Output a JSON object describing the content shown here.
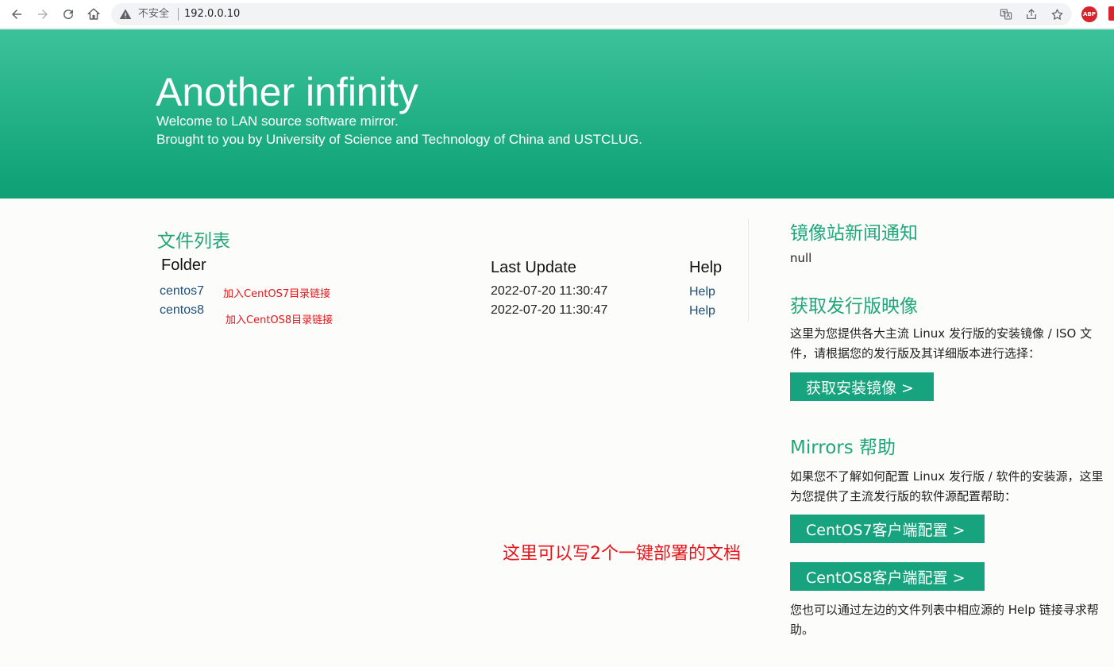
{
  "browser": {
    "security_label": "不安全",
    "url": "192.0.0.10",
    "abp_label": "ABP"
  },
  "header": {
    "title": "Another infinity",
    "line1": "Welcome to LAN source software mirror.",
    "line2": "Brought to you by University of Science and Technology of China and USTCLUG."
  },
  "files": {
    "title": "文件列表",
    "columns": {
      "folder": "Folder",
      "last_update": "Last Update",
      "help": "Help"
    },
    "rows": [
      {
        "folder": "centos7",
        "note": "加入CentOS7目录链接",
        "last_update": "2022-07-20 11:30:47",
        "help": "Help"
      },
      {
        "folder": "centos8",
        "note": "加入CentOS8目录链接",
        "last_update": "2022-07-20 11:30:47",
        "help": "Help"
      }
    ]
  },
  "annotation": "这里可以写2个一键部署的文档",
  "news": {
    "title": "镜像站新闻通知",
    "content": "null"
  },
  "distro": {
    "title": "获取发行版映像",
    "description": "这里为您提供各大主流 Linux 发行版的安装镜像 / ISO 文件，请根据您的发行版及其详细版本进行选择：",
    "button": "获取安装镜像 >"
  },
  "mirrors_help": {
    "title": "Mirrors 帮助",
    "description": "如果您不了解如何配置 Linux 发行版 / 软件的安装源，这里为您提供了主流发行版的软件源配置帮助：",
    "button_centos7": "CentOS7客户端配置 >",
    "button_centos8": "CentOS8客户端配置 >",
    "footer": "您也可以通过左边的文件列表中相应源的 Help 链接寻求帮助。"
  },
  "colors": {
    "accent": "#21a67c",
    "button": "#16a37d",
    "annotation": "#e8141a",
    "link": "#1d4f78"
  }
}
